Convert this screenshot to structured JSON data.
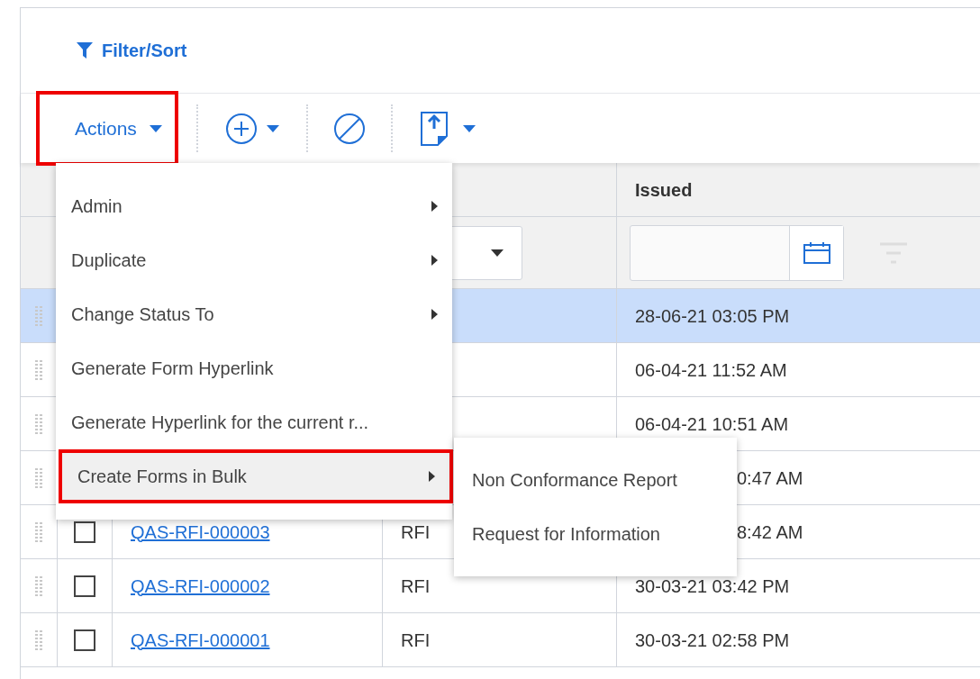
{
  "filter_sort": {
    "label": "Filter/Sort"
  },
  "toolbar": {
    "actions": {
      "label": "Actions",
      "annotated": true
    }
  },
  "table": {
    "header": {
      "issued": "Issued"
    },
    "rows": [
      {
        "selected": true,
        "issued": "28-06-21 03:05 PM"
      },
      {
        "selected": false,
        "issued": "06-04-21 11:52 AM"
      },
      {
        "selected": false,
        "issued": "06-04-21 10:51 AM"
      },
      {
        "selected": false,
        "issued": "0:47 AM"
      },
      {
        "selected": false,
        "checked": false,
        "id": "QAS-RFI-000003",
        "type": "RFI",
        "issued": "8:42 AM"
      },
      {
        "selected": false,
        "checked": false,
        "id": "QAS-RFI-000002",
        "type": "RFI",
        "issued": "30-03-21 03:42 PM"
      },
      {
        "selected": false,
        "checked": false,
        "id": "QAS-RFI-000001",
        "type": "RFI",
        "issued": "30-03-21 02:58 PM"
      }
    ]
  },
  "actions_menu": {
    "items": [
      {
        "label": "Admin",
        "submenu": true,
        "highlighted": false,
        "annotated": false
      },
      {
        "label": "Duplicate",
        "submenu": true,
        "highlighted": false,
        "annotated": false
      },
      {
        "label": "Change Status To",
        "submenu": true,
        "highlighted": false,
        "annotated": false
      },
      {
        "label": "Generate Form Hyperlink",
        "submenu": false,
        "highlighted": false,
        "annotated": false
      },
      {
        "label": "Generate Hyperlink for the current r...",
        "submenu": false,
        "highlighted": false,
        "annotated": false
      },
      {
        "label": "Create Forms in Bulk",
        "submenu": true,
        "highlighted": true,
        "annotated": true
      }
    ]
  },
  "submenu": {
    "items": [
      "Non Conformance Report",
      "Request for Information"
    ]
  }
}
